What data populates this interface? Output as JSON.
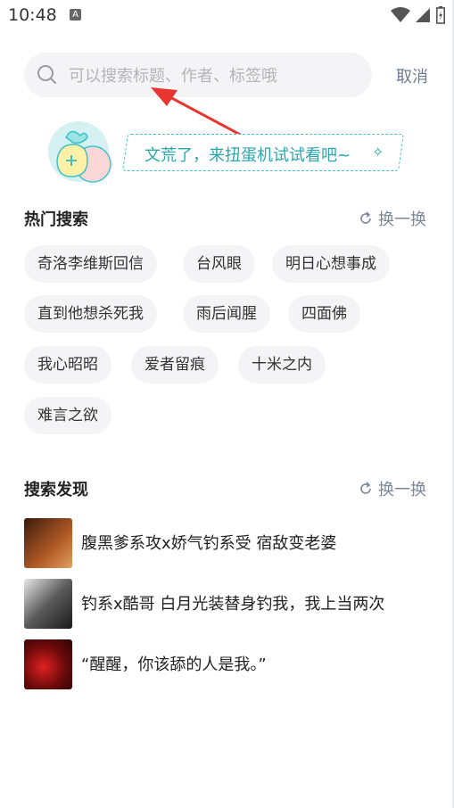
{
  "status": {
    "time": "10:48",
    "notif_icon": "A"
  },
  "search": {
    "placeholder": "可以搜索标题、作者、标签哦",
    "cancel_label": "取消"
  },
  "banner": {
    "text": "文荒了，来扭蛋机试试看吧~"
  },
  "hot": {
    "title": "热门搜索",
    "refresh_label": "换一换",
    "tags": [
      "奇洛李维斯回信",
      "台风眼",
      "明日心想事成",
      "直到他想杀死我",
      "雨后闻腥",
      "四面佛",
      "我心昭昭",
      "爱者留痕",
      "十米之内",
      "难言之欲"
    ]
  },
  "discover": {
    "title": "搜索发现",
    "refresh_label": "换一换",
    "items": [
      {
        "text": "腹黑爹系攻x娇气钓系受 宿敌变老婆",
        "cover_color": "#7a3a1c"
      },
      {
        "text": "钓系x酷哥 白月光装替身钓我，我上当两次",
        "cover_color": "#3a3a3a"
      },
      {
        "text": "“醒醒，你该舔的人是我。”",
        "cover_color": "#8e1414"
      }
    ]
  },
  "colors": {
    "accent": "#2aa6ad",
    "muted": "#7c8799",
    "tag_bg": "#f4f4f6",
    "arrow": "#e8352f"
  }
}
